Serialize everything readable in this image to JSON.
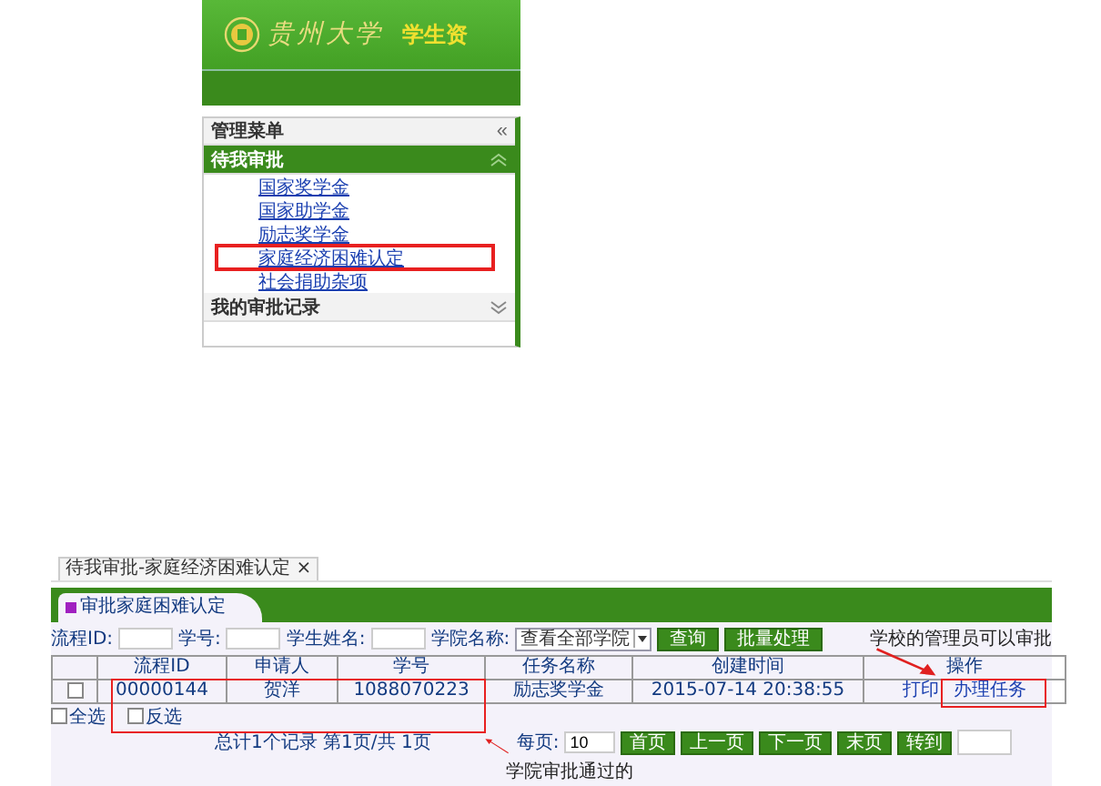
{
  "top_screenshot": {
    "header": {
      "logo_text": "贵州大学",
      "subtitle": "学生资"
    },
    "menu": {
      "title": "管理菜单",
      "collapse": "«",
      "groups": [
        {
          "label": "待我审批",
          "expanded": true,
          "items": [
            {
              "label": "国家奖学金",
              "annotated": false
            },
            {
              "label": "国家助学金",
              "annotated": false
            },
            {
              "label": "励志奖学金",
              "annotated": false
            },
            {
              "label": "家庭经济困难认定",
              "annotated": true
            },
            {
              "label": "社会捐助杂项",
              "annotated": false
            }
          ]
        },
        {
          "label": "我的审批记录",
          "expanded": false
        }
      ]
    }
  },
  "bottom_screenshot": {
    "tab": {
      "label": "待我审批-家庭经济困难认定",
      "close": "×"
    },
    "panel_title": "审批家庭困难认定",
    "filters": [
      {
        "label": "流程ID:",
        "kind": "input"
      },
      {
        "label": "学号:",
        "kind": "input"
      },
      {
        "label": "学生姓名:",
        "kind": "input"
      },
      {
        "label": "学院名称:",
        "kind": "select",
        "value": "查看全部学院"
      }
    ],
    "buttons": [
      "查询",
      "批量处理"
    ],
    "note_top": "学校的管理员可以审批",
    "table": {
      "columns": [
        "流程ID",
        "申请人",
        "学号",
        "任务名称",
        "创建时间",
        "操作"
      ],
      "rows": [
        {
          "checked": false,
          "cells": [
            "00000144",
            "贺洋",
            "1088070223",
            "励志奖学金",
            "2015-07-14 20:38:55"
          ],
          "actions": [
            "打印",
            "办理任务"
          ]
        }
      ]
    },
    "selection": [
      {
        "label": "全选",
        "checked": false
      },
      {
        "label": "反选",
        "checked": false
      }
    ],
    "summary": "总计1个记录 第1页/共 1页",
    "per_page_label": "每页:",
    "per_page": "10",
    "pager": [
      "首页",
      "上一页",
      "下一页",
      "末页",
      "转到"
    ],
    "note_bottom": "学院审批通过的"
  }
}
